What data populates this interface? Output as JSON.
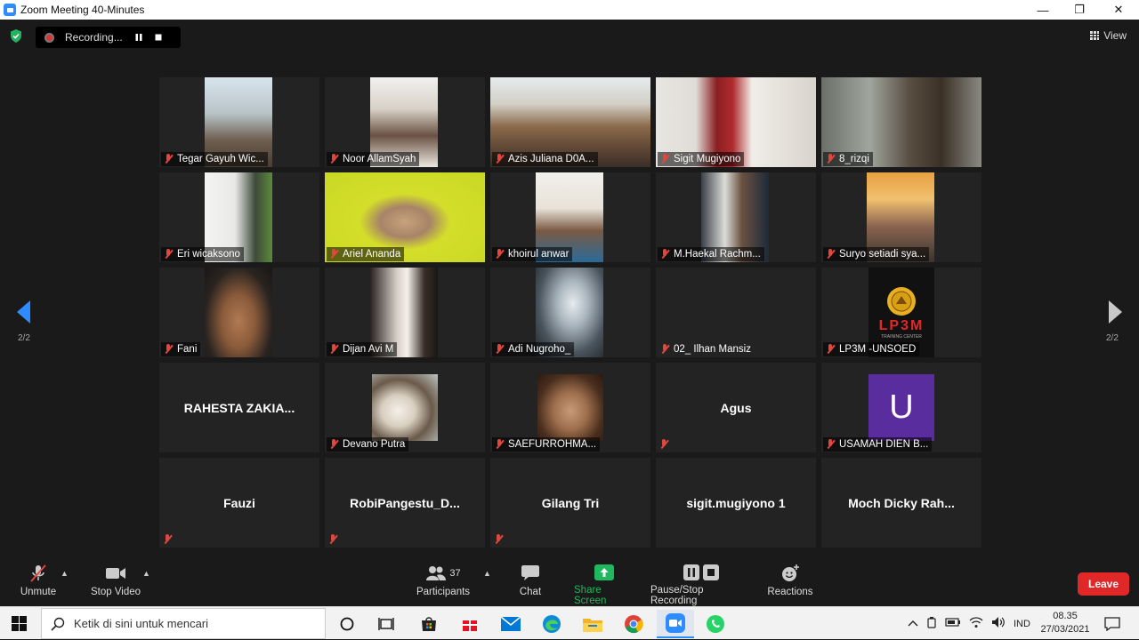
{
  "window": {
    "title": "Zoom Meeting 40-Minutes",
    "minimize": "—",
    "restore": "❐",
    "close": "✕"
  },
  "recording": {
    "label": "Recording..."
  },
  "view": {
    "label": "View"
  },
  "pager": {
    "left": "2/2",
    "right": "2/2"
  },
  "participants": [
    {
      "name": "Tegar Gayuh Wic...",
      "video": true
    },
    {
      "name": "Noor AllamSyah",
      "video": true
    },
    {
      "name": "Azis Juliana D0A...",
      "video": true
    },
    {
      "name": "Sigit Mugiyono",
      "video": true
    },
    {
      "name": "8_rizqi",
      "video": true
    },
    {
      "name": "Eri wicaksono",
      "video": true
    },
    {
      "name": "Ariel Ananda",
      "video": true
    },
    {
      "name": "khoirul anwar",
      "video": true
    },
    {
      "name": "M.Haekal Rachm...",
      "video": true
    },
    {
      "name": "Suryo setiadi sya...",
      "video": true
    },
    {
      "name": "Fani",
      "video": true
    },
    {
      "name": "Dijan Avi M",
      "video": true
    },
    {
      "name": "Adi Nugroho_",
      "video": true
    },
    {
      "name": "02_ Ilhan Mansiz",
      "video": false
    },
    {
      "name": "LP3M -UNSOED",
      "video": true
    },
    {
      "name": "RAHESTA ZAKIA...",
      "video": false
    },
    {
      "name": "Devano Putra",
      "video": true
    },
    {
      "name": "SAEFURROHMA...",
      "video": true
    },
    {
      "name": "Agus",
      "video": false
    },
    {
      "name": "USAMAH DIEN B...",
      "video": true
    },
    {
      "name": "Fauzi",
      "video": false
    },
    {
      "name": "RobiPangestu_D...",
      "video": false
    },
    {
      "name": "Gilang Tri",
      "video": false
    },
    {
      "name": "sigit.mugiyono 1",
      "video": false
    },
    {
      "name": "Moch Dicky Rah...",
      "video": false
    }
  ],
  "logo": {
    "text": "LP3M",
    "sub": "TRAINING CENTER"
  },
  "avatar_letter": "U",
  "toolbar": {
    "unmute": "Unmute",
    "stop_video": "Stop Video",
    "participants": "Participants",
    "participants_count": "37",
    "chat": "Chat",
    "share": "Share Screen",
    "pause_rec": "Pause/Stop Recording",
    "reactions": "Reactions",
    "leave": "Leave"
  },
  "taskbar": {
    "search_placeholder": "Ketik di sini untuk mencari",
    "lang": "IND",
    "time": "08.35",
    "date": "27/03/2021"
  },
  "colors": {
    "accent": "#2d8cff",
    "share": "#1fb85e",
    "leave": "#e02828",
    "muted": "#e0473e"
  }
}
